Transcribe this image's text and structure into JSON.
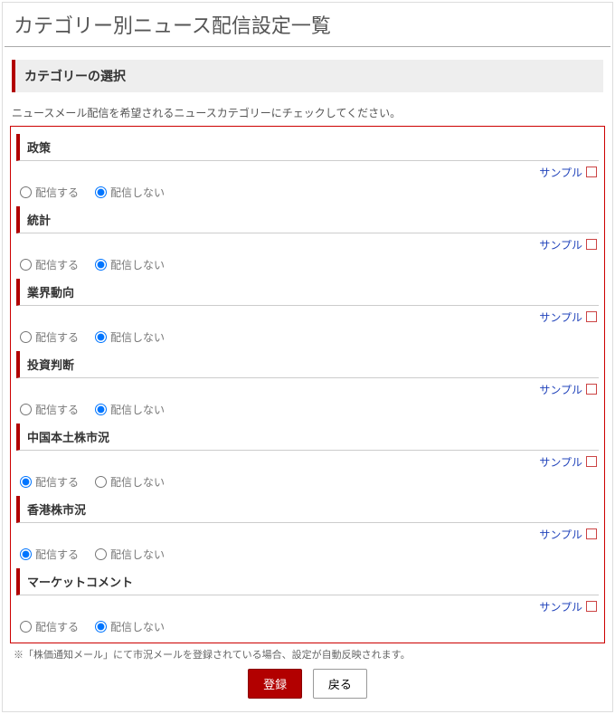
{
  "pageTitle": "カテゴリー別ニュース配信設定一覧",
  "section": {
    "heading": "カテゴリーの選択",
    "instruction": "ニュースメール配信を希望されるニュースカテゴリーにチェックしてください。"
  },
  "labels": {
    "deliver": "配信する",
    "noDeliver": "配信しない",
    "sample": "サンプル"
  },
  "categories": [
    {
      "id": "policy",
      "title": "政策",
      "selected": "no"
    },
    {
      "id": "statistics",
      "title": "統計",
      "selected": "no"
    },
    {
      "id": "industry",
      "title": "業界動向",
      "selected": "no"
    },
    {
      "id": "judgment",
      "title": "投資判断",
      "selected": "no"
    },
    {
      "id": "china",
      "title": "中国本土株市況",
      "selected": "yes"
    },
    {
      "id": "hk",
      "title": "香港株市況",
      "selected": "yes"
    },
    {
      "id": "market",
      "title": "マーケットコメント",
      "selected": "no"
    }
  ],
  "note": "※「株価通知メール」にて市況メールを登録されている場合、設定が自動反映されます。",
  "buttons": {
    "submit": "登録",
    "back": "戻る"
  }
}
